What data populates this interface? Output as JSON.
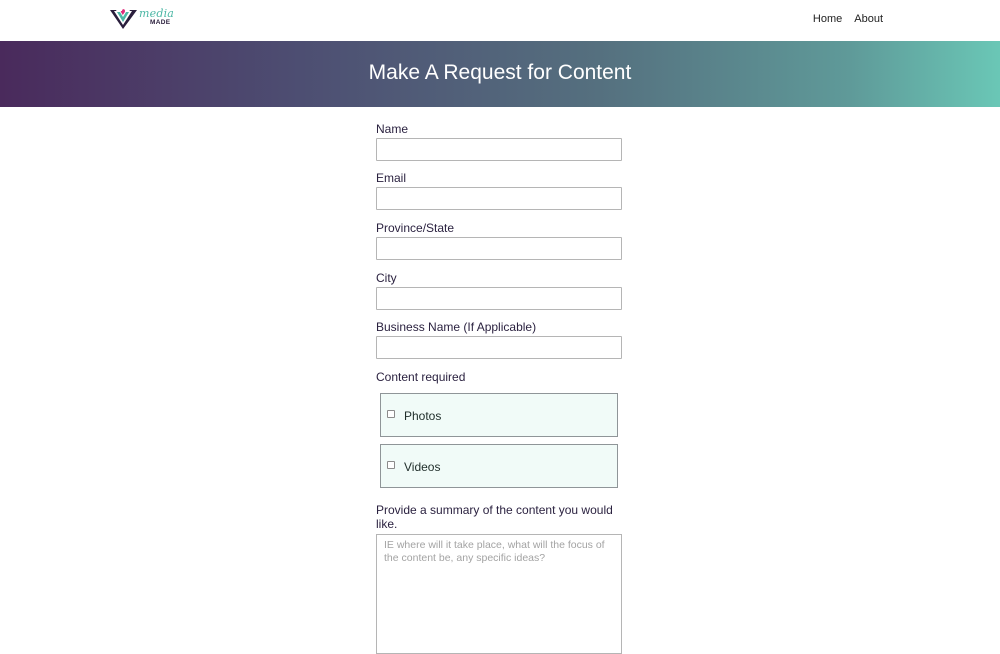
{
  "nav": {
    "logo_top": "media",
    "logo_bottom": "MADE",
    "links": [
      "Home",
      "About"
    ]
  },
  "hero": {
    "title": "Make A Request for Content"
  },
  "form": {
    "fields": [
      {
        "label": "Name",
        "value": ""
      },
      {
        "label": "Email",
        "value": ""
      },
      {
        "label": "Province/State",
        "value": ""
      },
      {
        "label": "City",
        "value": ""
      },
      {
        "label": "Business Name (If Applicable)",
        "value": ""
      }
    ],
    "content_required_label": "Content required",
    "options": [
      {
        "label": "Photos",
        "checked": false
      },
      {
        "label": "Videos",
        "checked": false
      }
    ],
    "summary_label": "Provide a summary of the content you would like.",
    "summary_placeholder": "IE where will it take place, what will the focus of the content be, any specific ideas?"
  },
  "colors": {
    "hero_start": "#4a2a5c",
    "hero_end": "#6ac7b6",
    "logo_teal": "#4cb7a5",
    "logo_pink": "#e02a7a"
  }
}
